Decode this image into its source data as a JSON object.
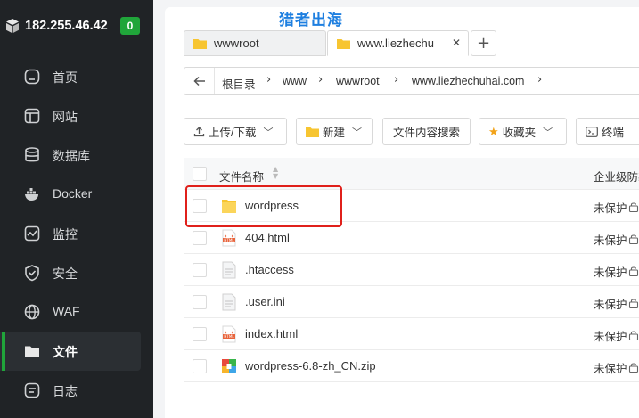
{
  "sidebar": {
    "host_ip": "182.255.46.42",
    "badge": "0",
    "items": [
      {
        "label": "首页",
        "icon": "home-icon"
      },
      {
        "label": "网站",
        "icon": "website-icon"
      },
      {
        "label": "数据库",
        "icon": "database-icon"
      },
      {
        "label": "Docker",
        "icon": "docker-icon"
      },
      {
        "label": "监控",
        "icon": "monitor-icon"
      },
      {
        "label": "安全",
        "icon": "shield-icon"
      },
      {
        "label": "WAF",
        "icon": "globe-icon"
      },
      {
        "label": "文件",
        "icon": "folder-icon",
        "active": true
      },
      {
        "label": "日志",
        "icon": "log-icon"
      }
    ]
  },
  "watermark": "猎者出海",
  "tabs": [
    {
      "label": "wwwroot"
    },
    {
      "label": "www.liezhechu",
      "close": "✕",
      "active": true
    }
  ],
  "tab_add": "+",
  "breadcrumb": [
    "根目录",
    "www",
    "wwwroot",
    "www.liezhechuhai.com"
  ],
  "toolbar": {
    "upload": "上传/下载",
    "new": "新建",
    "search": "文件内容搜索",
    "favorites": "收藏夹",
    "terminal": "终端"
  },
  "table": {
    "col_name": "文件名称",
    "col_protect": "企业级防篡",
    "rows": [
      {
        "name": "wordpress",
        "type": "folder",
        "status": "未保护"
      },
      {
        "name": "404.html",
        "type": "html",
        "status": "未保护"
      },
      {
        "name": ".htaccess",
        "type": "text",
        "status": "未保护"
      },
      {
        "name": ".user.ini",
        "type": "text",
        "status": "未保护"
      },
      {
        "name": "index.html",
        "type": "html",
        "status": "未保护"
      },
      {
        "name": "wordpress-6.8-zh_CN.zip",
        "type": "zip",
        "status": "未保护"
      }
    ]
  },
  "colors": {
    "sidebar_bg": "#202326",
    "accent_green": "#20a53a",
    "highlight_red": "#e0201b",
    "watermark_blue": "#1e7fe0",
    "folder_yellow": "#f7c531"
  }
}
